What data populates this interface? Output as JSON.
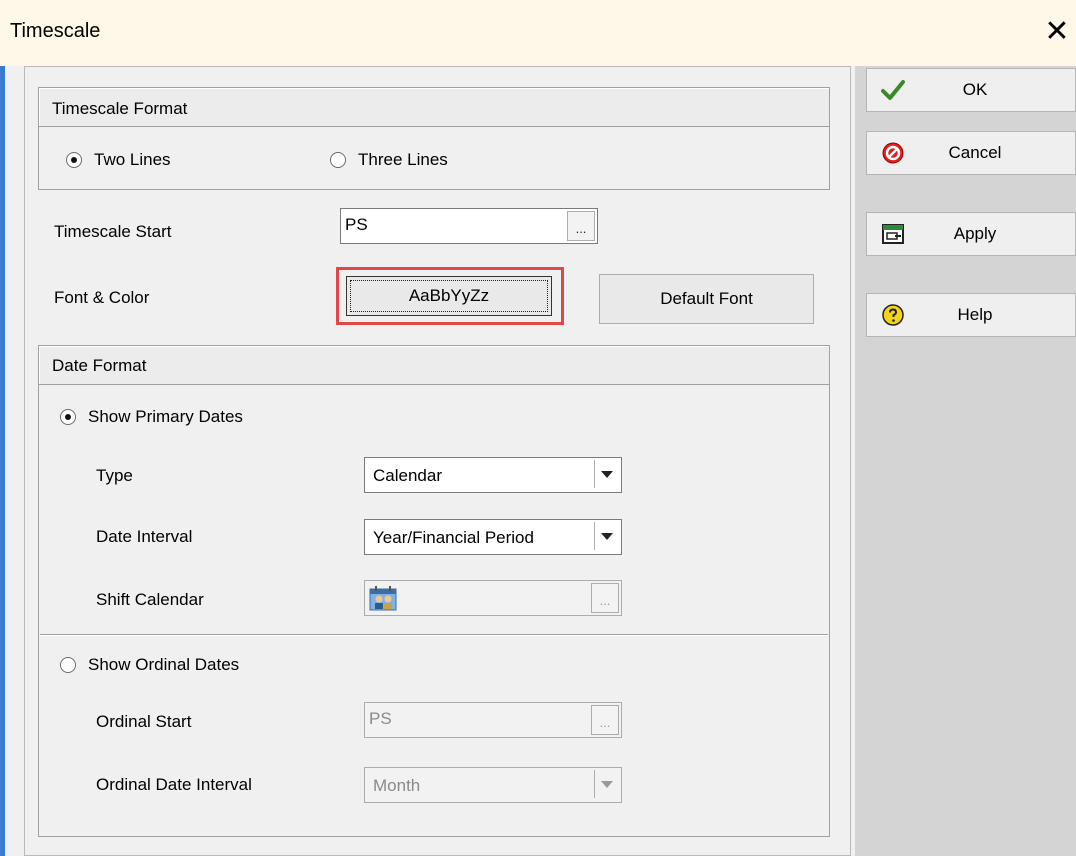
{
  "window": {
    "title": "Timescale",
    "close_glyph": "✕"
  },
  "timescale_format": {
    "header": "Timescale Format",
    "two_lines_label": "Two Lines",
    "three_lines_label": "Three Lines",
    "selected": "two_lines"
  },
  "timescale_start": {
    "label": "Timescale Start",
    "value": "PS",
    "browse": "..."
  },
  "font_color": {
    "label": "Font & Color",
    "sample_button": "AaBbYyZz",
    "default_font_button": "Default Font"
  },
  "date_format": {
    "header": "Date Format",
    "show_primary_label": "Show Primary Dates",
    "primary": {
      "type_label": "Type",
      "type_value": "Calendar",
      "interval_label": "Date Interval",
      "interval_value": "Year/Financial Period",
      "shift_label": "Shift Calendar",
      "shift_browse": "..."
    },
    "show_ordinal_label": "Show Ordinal Dates",
    "ordinal": {
      "start_label": "Ordinal Start",
      "start_value": "PS",
      "start_browse": "...",
      "interval_label": "Ordinal Date Interval",
      "interval_value": "Month"
    }
  },
  "side_buttons": {
    "ok": "OK",
    "cancel": "Cancel",
    "apply": "Apply",
    "help": "Help"
  },
  "colors": {
    "highlight": "#e04848",
    "accent": "#3a7cd0",
    "title_bg": "#fff8e8"
  }
}
